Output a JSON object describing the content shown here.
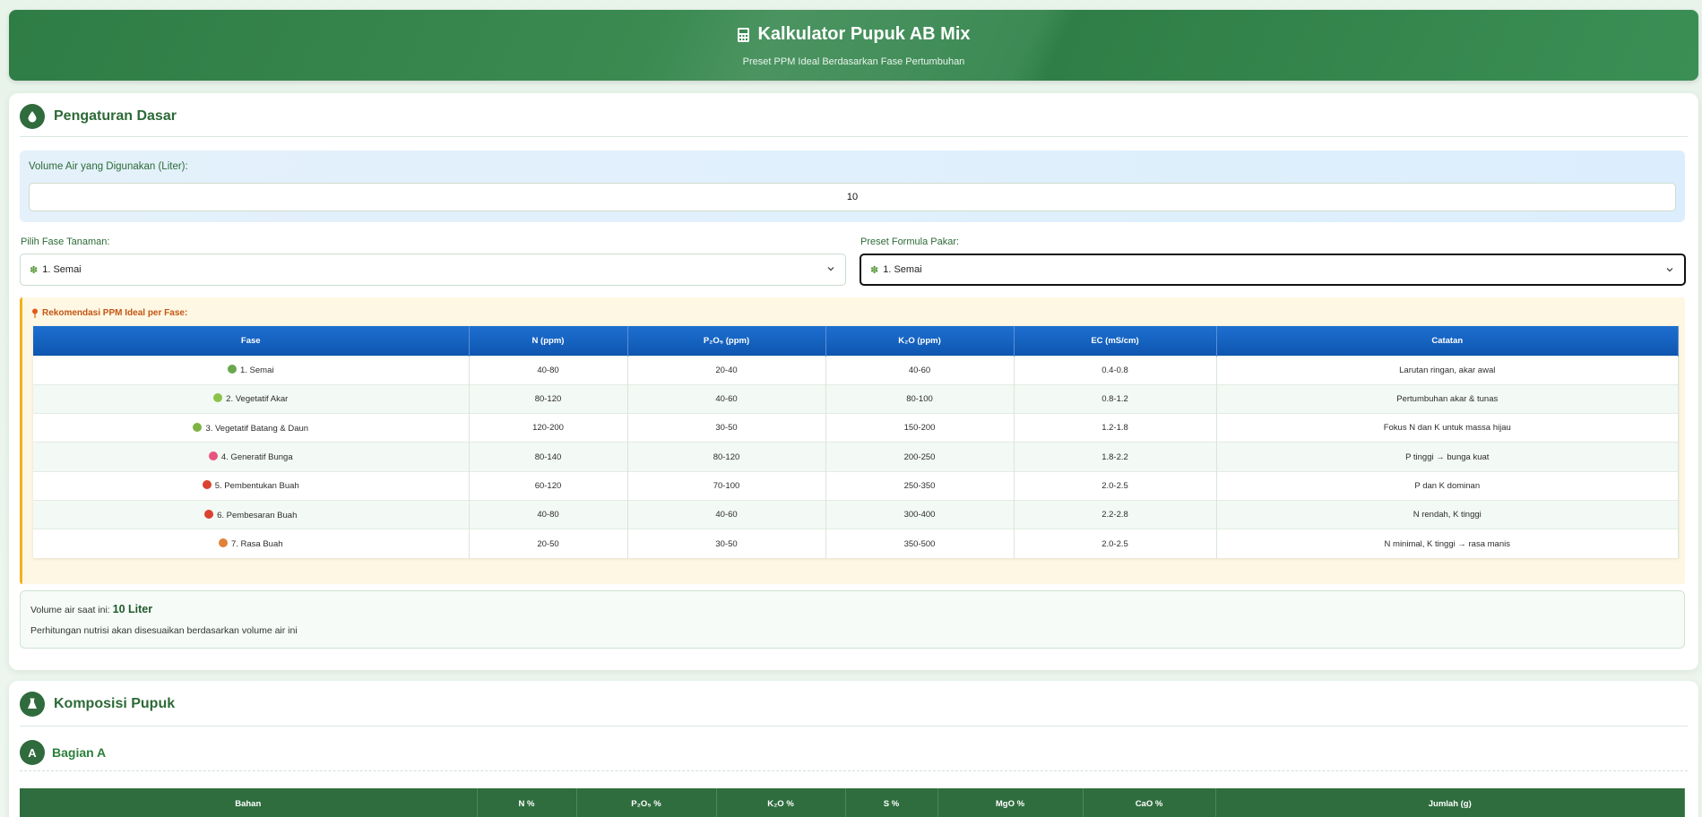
{
  "header": {
    "title": "Kalkulator Pupuk AB Mix",
    "subtitle": "Preset PPM Ideal Berdasarkan Fase Pertumbuhan"
  },
  "settings": {
    "title": "Pengaturan Dasar",
    "water_label": "Volume Air yang Digunakan (Liter):",
    "water_value": "10",
    "phase_label": "Pilih Fase Tanaman:",
    "phase_selected": "1. Semai",
    "preset_label": "Preset Formula Pakar:",
    "preset_selected": "1. Semai"
  },
  "recommendation": {
    "title": "Rekomendasi PPM Ideal per Fase:",
    "columns": [
      "Fase",
      "N (ppm)",
      "P₂O₅ (ppm)",
      "K₂O (ppm)",
      "EC (mS/cm)",
      "Catatan"
    ],
    "rows": [
      {
        "phase": "1. Semai",
        "icon": "seedling-icon",
        "color": "#6aa84f",
        "n": "40-80",
        "p": "20-40",
        "k": "40-60",
        "ec": "0.4-0.8",
        "note": "Larutan ringan, akar awal"
      },
      {
        "phase": "2. Vegetatif Akar",
        "icon": "herb-icon",
        "color": "#8bc34a",
        "n": "80-120",
        "p": "40-60",
        "k": "80-100",
        "ec": "0.8-1.2",
        "note": "Pertumbuhan akar & tunas"
      },
      {
        "phase": "3. Vegetatif Batang & Daun",
        "icon": "herb-icon",
        "color": "#7cb342",
        "n": "120-200",
        "p": "30-50",
        "k": "150-200",
        "ec": "1.2-1.8",
        "note": "Fokus N dan K untuk massa hijau"
      },
      {
        "phase": "4. Generatif Bunga",
        "icon": "flower-icon",
        "color": "#e75480",
        "n": "80-140",
        "p": "80-120",
        "k": "200-250",
        "ec": "1.8-2.2",
        "note": "P tinggi → bunga kuat"
      },
      {
        "phase": "5. Pembentukan Buah",
        "icon": "tomato-icon",
        "color": "#d9432f",
        "n": "60-120",
        "p": "70-100",
        "k": "250-350",
        "ec": "2.0-2.5",
        "note": "P dan K dominan"
      },
      {
        "phase": "6. Pembesaran Buah",
        "icon": "tomato-icon",
        "color": "#d9432f",
        "n": "40-80",
        "p": "40-60",
        "k": "300-400",
        "ec": "2.2-2.8",
        "note": "N rendah, K tinggi"
      },
      {
        "phase": "7. Rasa Buah",
        "icon": "peach-icon",
        "color": "#e0823a",
        "n": "20-50",
        "p": "30-50",
        "k": "350-500",
        "ec": "2.0-2.5",
        "note": "N minimal, K tinggi → rasa manis"
      }
    ]
  },
  "info": {
    "prefix": "Volume air saat ini:",
    "value": "10 Liter",
    "note": "Perhitungan nutrisi akan disesuaikan berdasarkan volume air ini"
  },
  "composition": {
    "title": "Komposisi Pupuk",
    "part_letter": "A",
    "part_title": "Bagian A",
    "columns": [
      "Bahan",
      "N %",
      "P₂O₅ %",
      "K₂O %",
      "S %",
      "MgO %",
      "CaO %",
      "Jumlah (g)"
    ]
  }
}
